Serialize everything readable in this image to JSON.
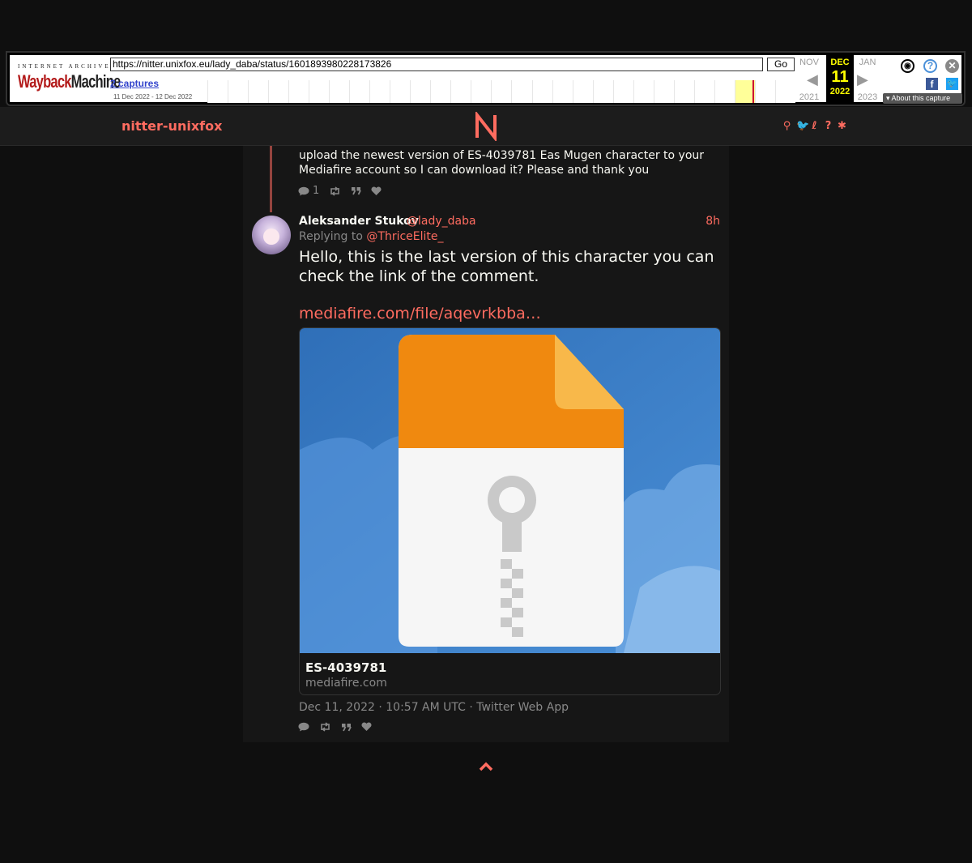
{
  "wayback": {
    "logo_top": "INTERNET ARCHIVE",
    "logo_main_a": "Wayback",
    "logo_main_b": "Machine",
    "url": "https://nitter.unixfox.eu/lady_daba/status/1601893980228173826",
    "go_label": "Go",
    "captures": "2 captures",
    "date_range": "11 Dec 2022 - 12 Dec 2022",
    "prev_month": "NOV",
    "cur_month": "DEC",
    "next_month": "JAN",
    "cur_day": "11",
    "prev_year": "2021",
    "cur_year": "2022",
    "next_year": "2023",
    "about": "About this capture"
  },
  "nav": {
    "site_name": "nitter-unixfox",
    "icons": [
      "search-icon",
      "twitter-icon",
      "rss-icon",
      "help-icon",
      "settings-icon"
    ],
    "accent": "#ff6c60"
  },
  "prev_tweet": {
    "text": "upload the newest version of ES-4039781 Eas Mugen character to your Mediafire account so I can download it? Please and thank you",
    "replies": "1"
  },
  "tweet": {
    "fullname": "Aleksander Stukov",
    "username": "@lady_daba",
    "date": "8h",
    "replying_label": "Replying to",
    "replying_to": "@ThriceElite_",
    "text": "Hello, this is the last version of this character you can check the link of the comment.",
    "link": "mediafire.com/file/aqevrkbba…",
    "card_title": "ES-4039781",
    "card_destination": "mediafire.com",
    "published_date": "Dec 11, 2022",
    "published_time": "10:57 AM UTC",
    "source": "Twitter Web App",
    "sep": "·"
  }
}
